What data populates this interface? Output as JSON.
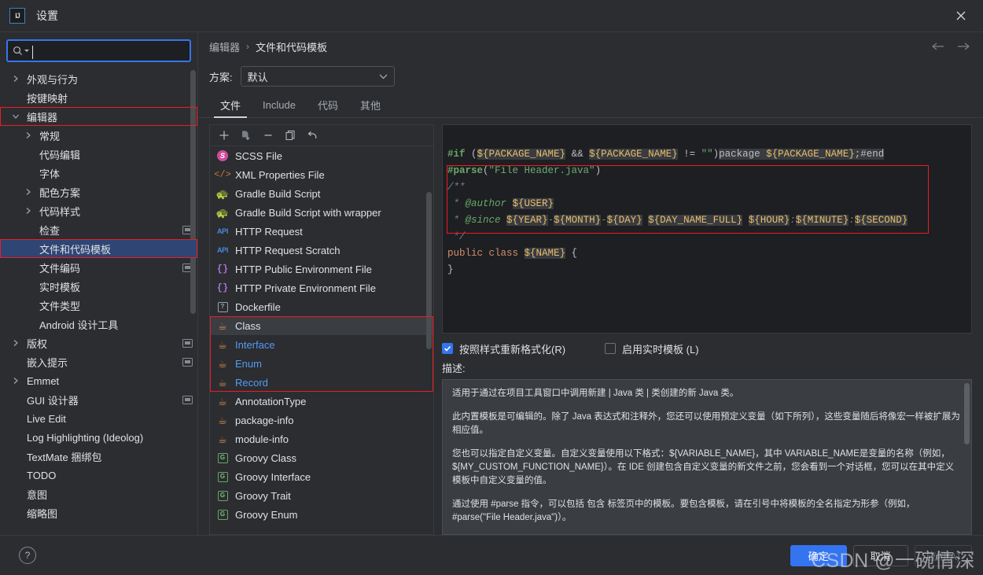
{
  "window": {
    "title": "设置",
    "logo_text": "IJ",
    "close_icon": "close-icon"
  },
  "search": {
    "placeholder": "",
    "value": ""
  },
  "sidebar": {
    "items": [
      {
        "label": "外观与行为",
        "level": 0,
        "arrow": "collapsed",
        "badge": false
      },
      {
        "label": "按键映射",
        "level": 0,
        "arrow": "none",
        "badge": false
      },
      {
        "label": "编辑器",
        "level": 0,
        "arrow": "expanded",
        "badge": false,
        "redbox": true
      },
      {
        "label": "常规",
        "level": 1,
        "arrow": "collapsed",
        "badge": false
      },
      {
        "label": "代码编辑",
        "level": 1,
        "arrow": "none",
        "badge": false
      },
      {
        "label": "字体",
        "level": 1,
        "arrow": "none",
        "badge": false
      },
      {
        "label": "配色方案",
        "level": 1,
        "arrow": "collapsed",
        "badge": false
      },
      {
        "label": "代码样式",
        "level": 1,
        "arrow": "collapsed",
        "badge": false
      },
      {
        "label": "检查",
        "level": 1,
        "arrow": "none",
        "badge": true
      },
      {
        "label": "文件和代码模板",
        "level": 1,
        "arrow": "none",
        "badge": false,
        "selected": true,
        "redbox": true
      },
      {
        "label": "文件编码",
        "level": 1,
        "arrow": "none",
        "badge": true
      },
      {
        "label": "实时模板",
        "level": 1,
        "arrow": "none",
        "badge": false
      },
      {
        "label": "文件类型",
        "level": 1,
        "arrow": "none",
        "badge": false
      },
      {
        "label": "Android 设计工具",
        "level": 1,
        "arrow": "none",
        "badge": false
      },
      {
        "label": "版权",
        "level": 0,
        "arrow": "collapsed",
        "badge": true
      },
      {
        "label": "嵌入提示",
        "level": 0,
        "arrow": "none",
        "badge": true
      },
      {
        "label": "Emmet",
        "level": 0,
        "arrow": "collapsed",
        "badge": false
      },
      {
        "label": "GUI 设计器",
        "level": 0,
        "arrow": "none",
        "badge": true
      },
      {
        "label": "Live Edit",
        "level": 0,
        "arrow": "none",
        "badge": false
      },
      {
        "label": "Log Highlighting (Ideolog)",
        "level": 0,
        "arrow": "none",
        "badge": false
      },
      {
        "label": "TextMate 捆绑包",
        "level": 0,
        "arrow": "none",
        "badge": false
      },
      {
        "label": "TODO",
        "level": 0,
        "arrow": "none",
        "badge": false
      },
      {
        "label": "意图",
        "level": 0,
        "arrow": "none",
        "badge": false
      },
      {
        "label": "缩略图",
        "level": 0,
        "arrow": "none",
        "badge": false
      }
    ]
  },
  "breadcrumb": {
    "parent": "编辑器",
    "separator": "›",
    "current": "文件和代码模板",
    "back_icon": "arrow-left-icon",
    "forward_icon": "arrow-right-icon"
  },
  "scheme": {
    "label": "方案:",
    "value": "默认"
  },
  "tabs": [
    {
      "label": "文件",
      "active": true
    },
    {
      "label": "Include",
      "active": false
    },
    {
      "label": "代码",
      "active": false
    },
    {
      "label": "其他",
      "active": false
    }
  ],
  "list_toolbar": [
    {
      "icon": "plus-icon",
      "name": "add-template-button"
    },
    {
      "icon": "copy-template-icon",
      "name": "create-from-template-button"
    },
    {
      "icon": "minus-icon",
      "name": "remove-template-button"
    },
    {
      "icon": "duplicate-icon",
      "name": "duplicate-template-button"
    },
    {
      "icon": "reset-icon",
      "name": "reset-template-button"
    }
  ],
  "templates": [
    {
      "label": "SCSS File",
      "icon": "scss-icon"
    },
    {
      "label": "XML Properties File",
      "icon": "xml-icon"
    },
    {
      "label": "Gradle Build Script",
      "icon": "gradle-icon"
    },
    {
      "label": "Gradle Build Script with wrapper",
      "icon": "gradle-icon"
    },
    {
      "label": "HTTP Request",
      "icon": "api-icon"
    },
    {
      "label": "HTTP Request Scratch",
      "icon": "api-icon"
    },
    {
      "label": "HTTP Public Environment File",
      "icon": "braces-icon"
    },
    {
      "label": "HTTP Private Environment File",
      "icon": "braces-icon"
    },
    {
      "label": "Dockerfile",
      "icon": "dockerfile-icon"
    },
    {
      "label": "Class",
      "icon": "java-icon",
      "selected": true
    },
    {
      "label": "Interface",
      "icon": "java-icon",
      "blue": true
    },
    {
      "label": "Enum",
      "icon": "java-icon",
      "blue": true
    },
    {
      "label": "Record",
      "icon": "java-icon",
      "blue": true
    },
    {
      "label": "AnnotationType",
      "icon": "java-icon"
    },
    {
      "label": "package-info",
      "icon": "java-icon"
    },
    {
      "label": "module-info",
      "icon": "java-icon"
    },
    {
      "label": "Groovy Class",
      "icon": "groovy-icon"
    },
    {
      "label": "Groovy Interface",
      "icon": "groovy-icon"
    },
    {
      "label": "Groovy Trait",
      "icon": "groovy-icon"
    },
    {
      "label": "Groovy Enum",
      "icon": "groovy-icon"
    }
  ],
  "code": {
    "lines": [
      "#if (${PACKAGE_NAME} && ${PACKAGE_NAME} != \"\")package ${PACKAGE_NAME};#end",
      "#parse(\"File Header.java\")",
      "/**",
      " * @author ${USER}",
      " * @since ${YEAR}-${MONTH}-${DAY} ${DAY_NAME_FULL} ${HOUR}:${MINUTE}:${SECOND}",
      " */",
      "public class ${NAME} {",
      "}"
    ]
  },
  "options": {
    "reformat": {
      "label": "按照样式重新格式化(R)",
      "mnemonic": "R",
      "checked": true
    },
    "live_template": {
      "label": "启用实时模板 (L)",
      "mnemonic": "L",
      "checked": false
    }
  },
  "description": {
    "label": "描述:",
    "paragraphs": [
      "适用于通过在项目工具窗口中调用新建 | Java 类 | 类创建的新 Java 类。",
      "此内置模板是可编辑的。除了 Java 表达式和注释外，您还可以使用预定义变量（如下所列），这些变量随后将像宏一样被扩展为相应值。",
      "您也可以指定自定义变量。自定义变量使用以下格式：${VARIABLE_NAME}，其中 VARIABLE_NAME是变量的名称（例如，${MY_CUSTOM_FUNCTION_NAME}）。在 IDE 创建包含自定义变量的新文件之前，您会看到一个对话框，您可以在其中定义模板中自定义变量的值。",
      "通过使用 #parse 指令，可以包括 包含 标签页中的模板。要包含模板，请在引号中将模板的全名指定为形参（例如，#parse(\"File Header.java\")）。"
    ]
  },
  "footer": {
    "help_icon": "help-icon",
    "ok_label": "确定",
    "cancel_label": "取消",
    "apply_label": "应用(A)"
  },
  "watermark": "CSDN @一碗情深",
  "colors": {
    "accent": "#3574f0",
    "highlight_box": "#ed1c24",
    "selection": "#2f4573",
    "background": "#2b2d30",
    "editor_background": "#1e1f22",
    "link": "#549bf5"
  }
}
